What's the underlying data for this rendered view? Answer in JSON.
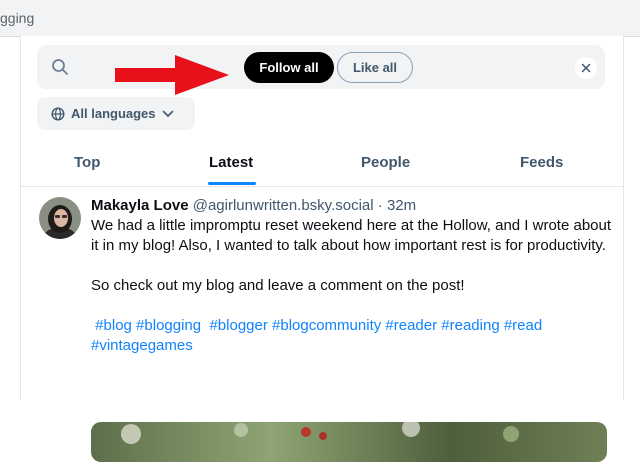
{
  "browser": {
    "url_fragment": "gging"
  },
  "search": {
    "follow_all_label": "Follow all",
    "like_all_label": "Like all"
  },
  "language_filter": {
    "label": "All languages"
  },
  "tabs": [
    {
      "label": "Top",
      "active": false
    },
    {
      "label": "Latest",
      "active": true
    },
    {
      "label": "People",
      "active": false
    },
    {
      "label": "Feeds",
      "active": false
    }
  ],
  "post": {
    "author_name": "Makayla Love",
    "handle": "@agirlunwritten.bsky.social",
    "separator": "·",
    "time": "32m",
    "text_lines": [
      "We had a little impromptu reset weekend here at the Hollow, and I wrote about it in my blog! Also, I wanted to talk about how important rest is for productivity.",
      "So check out my blog and leave a comment on the post!"
    ],
    "hashtags": [
      "#blog",
      "#blogging",
      "#blogger",
      "#blogcommunity",
      "#reader",
      "#reading",
      "#read",
      "#vintagegames"
    ]
  },
  "colors": {
    "accent": "#1083fe",
    "arrow": "#e8101a",
    "follow_button": "#000000",
    "muted_text": "#42576c"
  },
  "icons": {
    "search": "search-icon",
    "clear": "close-icon",
    "language": "globe-icon",
    "dropdown": "chevron-down-icon"
  }
}
